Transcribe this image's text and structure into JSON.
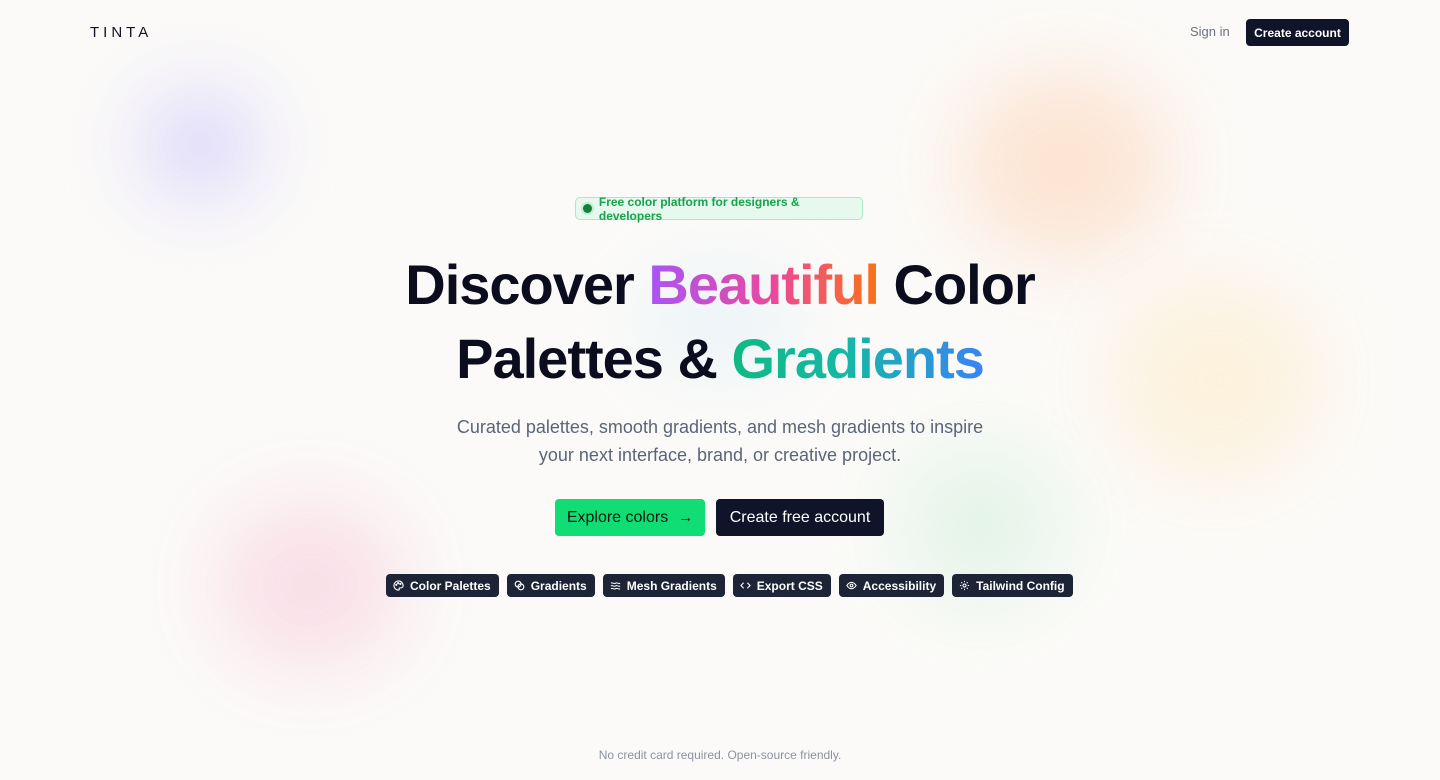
{
  "header": {
    "logo": "TINTA",
    "sign_in": "Sign in",
    "create_account": "Create account"
  },
  "badge": {
    "text": "Free color platform for designers & developers"
  },
  "hero": {
    "title_part1": "Discover ",
    "title_highlight1": "Beautiful",
    "title_part2": " Color",
    "title_part3": "Palettes & ",
    "title_highlight2": "Gradients",
    "subtitle_line1": "Curated palettes, smooth gradients, and mesh gradients to inspire",
    "subtitle_line2": "your next interface, brand, or creative project."
  },
  "cta": {
    "explore": "Explore colors",
    "explore_icon": "arrow-right-icon",
    "create_free": "Create free account"
  },
  "chips": [
    {
      "label": "Color Palettes",
      "icon": "palette-icon"
    },
    {
      "label": "Gradients",
      "icon": "gradient-icon"
    },
    {
      "label": "Mesh Gradients",
      "icon": "waves-icon"
    },
    {
      "label": "Export CSS",
      "icon": "code-icon"
    },
    {
      "label": "Accessibility",
      "icon": "eye-icon"
    },
    {
      "label": "Tailwind Config",
      "icon": "settings-icon"
    }
  ],
  "footer": {
    "note": "No credit card required. Open-source friendly."
  },
  "colors": {
    "primary_dark": "#0f1429",
    "accent_green": "#10dd73",
    "badge_green": "#16a34a",
    "background": "#fbfaf8"
  }
}
